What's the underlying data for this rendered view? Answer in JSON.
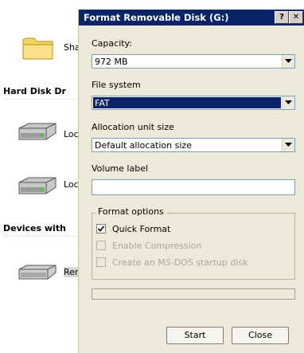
{
  "explorer": {
    "shared_label": "Sha",
    "hard_disk_header": "Hard Disk Dr",
    "local_disk_1": "Loc",
    "local_disk_2": "Loc",
    "devices_header": "Devices with",
    "removable_label": "Rer"
  },
  "dialog": {
    "title": "Format Removable Disk (G:)",
    "help_btn": "?",
    "close_btn": "✕",
    "capacity_label": "Capacity:",
    "capacity_value": "972 MB",
    "filesystem_label": "File system",
    "filesystem_value": "FAT",
    "alloc_label": "Allocation unit size",
    "alloc_value": "Default allocation size",
    "volume_label": "Volume label",
    "volume_value": "",
    "format_options_title": "Format options",
    "quick_format": "Quick Format",
    "quick_format_checked": true,
    "enable_compression": "Enable Compression",
    "msdos_startup": "Create an MS-DOS startup disk",
    "start_button": "Start",
    "close_button": "Close"
  },
  "colors": {
    "titlebar": "#0a246a",
    "dialog_bg": "#ece9d8",
    "selection": "#0a246a"
  }
}
